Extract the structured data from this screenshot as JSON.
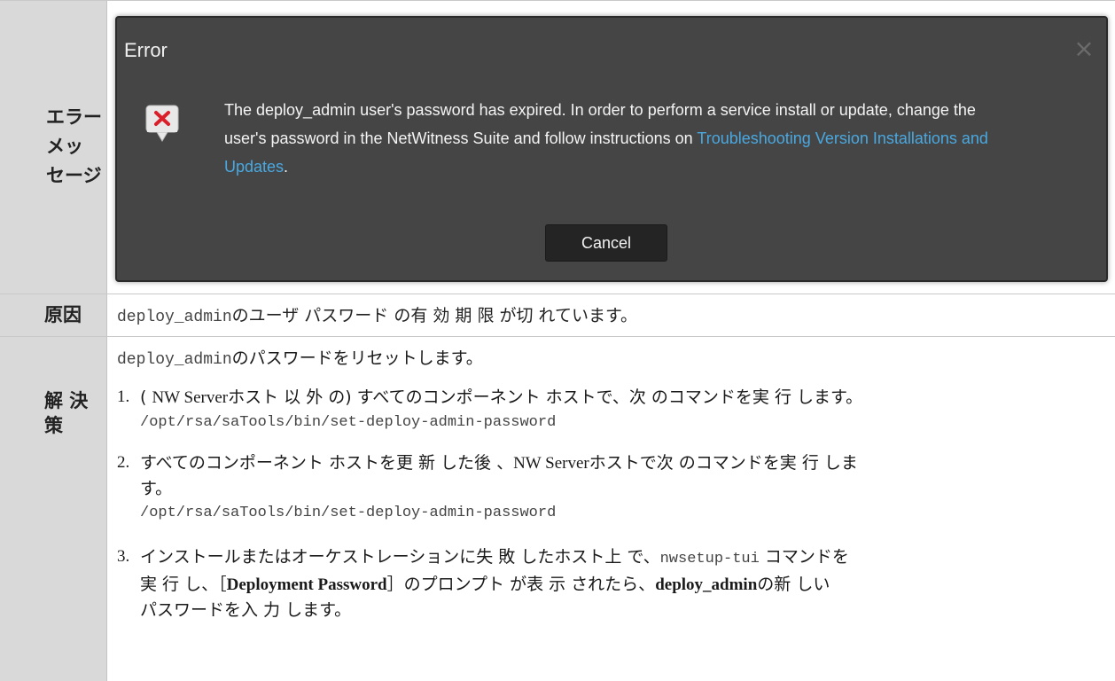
{
  "rows": {
    "error": {
      "label": "エラーメッセージ",
      "label_lines": [
        "エラー",
        "メッ",
        "セージ"
      ]
    },
    "cause": {
      "label": "原因",
      "text_mono": "deploy_admin",
      "text": "のユーザ パスワード の有 効 期 限 が切 れています。"
    },
    "solution": {
      "label_lines": [
        "解 決",
        "策"
      ],
      "intro_mono": "deploy_admin",
      "intro": "のパスワードをリセットします。",
      "steps": [
        {
          "num": "1.",
          "text_a": "( ",
          "text_serif": "NW Server",
          "text_b": "ホスト 以 外 の) すべてのコンポーネント ホストで、次 のコマンドを実 行 します。",
          "command": "/opt/rsa/saTools/bin/set-deploy-admin-password"
        },
        {
          "num": "2.",
          "text_a": "すべてのコンポーネント ホストを更 新 した後 、",
          "text_serif": "NW Server",
          "text_b": "ホストで次 のコマンドを実 行 しま",
          "text_c": "す。",
          "command": "/opt/rsa/saTools/bin/set-deploy-admin-password"
        },
        {
          "num": "3.",
          "text_a": "インストールまたはオーケストレーションに失 敗 したホスト上 で、",
          "text_mono": "nwsetup-tui",
          "text_b": " コマンドを",
          "text_c": "実 行 し、［",
          "text_bold": "Deployment Password",
          "text_d": "］のプロンプト が表 示 されたら、",
          "text_bold2": "deploy_admin",
          "text_e": "の新 しい",
          "text_f": "パスワードを入 力 します。"
        }
      ]
    }
  },
  "dialog": {
    "title": "Error",
    "close_glyph": "×",
    "message": "The deploy_admin user's password has expired. In order to perform a service install or update, change the user's password in the NetWitness Suite and follow instructions on",
    "link_text": "Troubleshooting Version Installations and Updates",
    "message_end": ".",
    "cancel_label": "Cancel",
    "icon": "error-x-icon"
  },
  "colors": {
    "label_bg": "#d9d9d9",
    "dialog_bg": "#454545",
    "link": "#4aa8e0",
    "error_red": "#d9202a"
  }
}
